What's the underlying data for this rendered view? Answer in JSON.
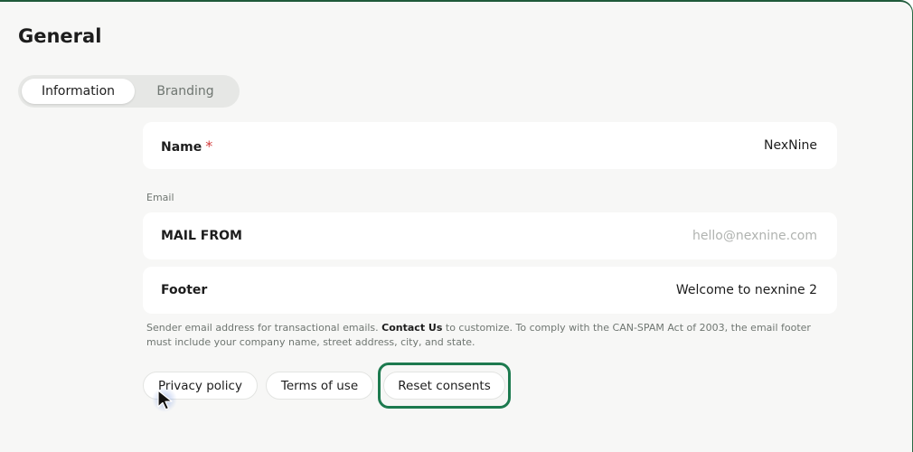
{
  "page": {
    "title": "General"
  },
  "tabs": [
    {
      "label": "Information",
      "active": true
    },
    {
      "label": "Branding",
      "active": false
    }
  ],
  "fields": {
    "name": {
      "label": "Name",
      "required_mark": "*",
      "value": "NexNine"
    },
    "email_section_label": "Email",
    "mail_from": {
      "label": "MAIL FROM",
      "placeholder": "hello@nexnine.com"
    },
    "footer": {
      "label": "Footer",
      "value": "Welcome to nexnine 2"
    }
  },
  "help": {
    "prefix": "Sender email address for transactional emails. ",
    "link": "Contact Us",
    "suffix": " to customize. To comply with the CAN-SPAM Act of 2003, the email footer must include your company name, street address, city, and state."
  },
  "actions": {
    "privacy_policy": "Privacy policy",
    "terms_of_use": "Terms of use",
    "reset_consents": "Reset consents"
  },
  "colors": {
    "accent": "#1d7a4f",
    "required": "#d23a3a",
    "muted_text": "#6f7671",
    "background": "#f7f7f6"
  }
}
